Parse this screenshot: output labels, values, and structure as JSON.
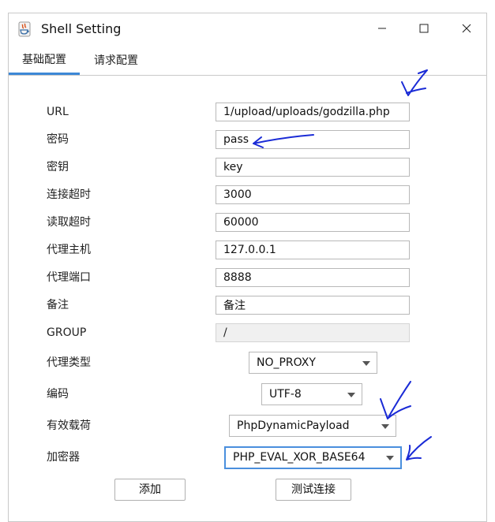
{
  "window": {
    "title": "Shell Setting"
  },
  "tabs": [
    {
      "label": "基础配置",
      "active": true
    },
    {
      "label": "请求配置",
      "active": false
    }
  ],
  "form": {
    "url": {
      "label": "URL",
      "value": "1/upload/uploads/godzilla.php"
    },
    "password": {
      "label": "密码",
      "value": "pass"
    },
    "key": {
      "label": "密钥",
      "value": "key"
    },
    "connect_timeout": {
      "label": "连接超时",
      "value": "3000"
    },
    "read_timeout": {
      "label": "读取超时",
      "value": "60000"
    },
    "proxy_host": {
      "label": "代理主机",
      "value": "127.0.0.1"
    },
    "proxy_port": {
      "label": "代理端口",
      "value": "8888"
    },
    "remark": {
      "label": "备注",
      "value": "备注"
    },
    "group": {
      "label": "GROUP",
      "value": "/"
    },
    "proxy_type": {
      "label": "代理类型",
      "value": "NO_PROXY"
    },
    "encoding": {
      "label": "编码",
      "value": "UTF-8"
    },
    "payload": {
      "label": "有效载荷",
      "value": "PhpDynamicPayload"
    },
    "cryption": {
      "label": "加密器",
      "value": "PHP_EVAL_XOR_BASE64"
    }
  },
  "buttons": {
    "add": "添加",
    "test": "测试连接"
  },
  "icons": {
    "app": "java-app-icon",
    "minimize": "minimize-icon",
    "maximize": "maximize-icon",
    "close": "close-icon"
  },
  "colors": {
    "tab_accent": "#3d88d6",
    "focus_border": "#4a8fdd",
    "annotation_ink": "#1a2bd6"
  }
}
